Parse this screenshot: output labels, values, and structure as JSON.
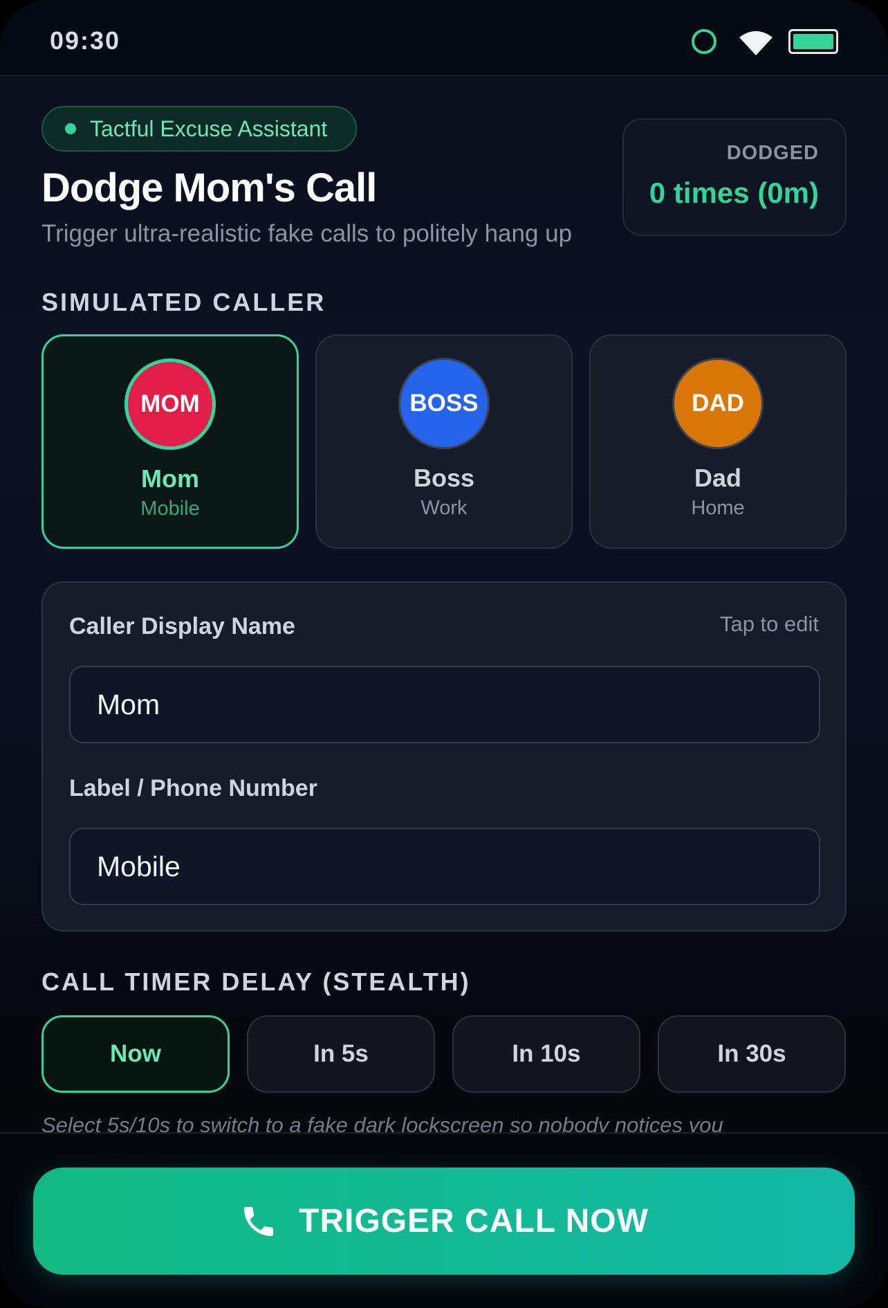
{
  "status_bar": {
    "time": "09:30"
  },
  "header": {
    "badge": "Tactful Excuse Assistant",
    "title": "Dodge Mom's Call",
    "subtitle": "Trigger ultra-realistic fake calls to politely hang up",
    "dodged_label": "DODGED",
    "dodged_value": "0 times (0m)"
  },
  "callers": {
    "section_label": "SIMULATED CALLER",
    "items": [
      {
        "avatar": "MOM",
        "name": "Mom",
        "sub": "Mobile",
        "color": "#e11d48",
        "selected": true
      },
      {
        "avatar": "BOSS",
        "name": "Boss",
        "sub": "Work",
        "color": "#2563eb",
        "selected": false
      },
      {
        "avatar": "DAD",
        "name": "Dad",
        "sub": "Home",
        "color": "#d97706",
        "selected": false
      }
    ]
  },
  "form": {
    "name_label": "Caller Display Name",
    "tap_hint": "Tap to edit",
    "name_value": "Mom",
    "number_label": "Label / Phone Number",
    "number_value": "Mobile"
  },
  "timer": {
    "section_label": "CALL TIMER DELAY (STEALTH)",
    "options": [
      {
        "label": "Now",
        "selected": true
      },
      {
        "label": "In 5s",
        "selected": false
      },
      {
        "label": "In 10s",
        "selected": false
      },
      {
        "label": "In 30s",
        "selected": false
      }
    ],
    "hint": "Select 5s/10s to switch to a fake dark lockscreen so nobody notices you"
  },
  "action": {
    "trigger_label": "TRIGGER CALL NOW",
    "icon": "phone-icon"
  },
  "colors": {
    "accent": "#34d399",
    "button_gradient_start": "#12b981",
    "button_gradient_end": "#14b8a6"
  }
}
